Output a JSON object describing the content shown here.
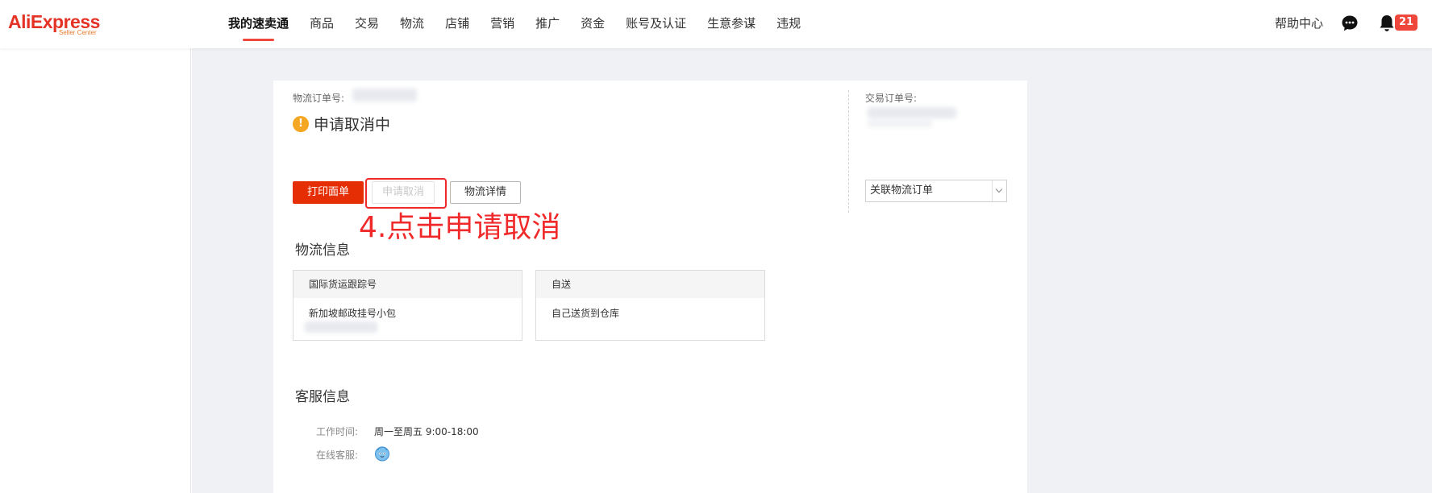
{
  "header": {
    "logo_text": "AliExpress",
    "logo_sub": "Seller Center",
    "nav": [
      "我的速卖通",
      "商品",
      "交易",
      "物流",
      "店铺",
      "营销",
      "推广",
      "资金",
      "账号及认证",
      "生意参谋",
      "违规"
    ],
    "active_index": 0,
    "help": "帮助中心",
    "notification_count": "21"
  },
  "order": {
    "logistics_order_label": "物流订单号:",
    "status": "申请取消中",
    "trade_order_label": "交易订单号:",
    "buttons": {
      "print": "打印面单",
      "cancel": "申请取消",
      "detail": "物流详情"
    },
    "related_select": "关联物流订单"
  },
  "annotation": "4.点击申请取消",
  "logistics_info": {
    "title": "物流信息",
    "boxes": [
      {
        "head": "国际货运跟踪号",
        "body": "新加坡邮政挂号小包"
      },
      {
        "head": "自送",
        "body": "自己送货到仓库"
      }
    ]
  },
  "service_info": {
    "title": "客服信息",
    "work_time_label": "工作时间:",
    "work_time_value": "周一至周五 9:00-18:00",
    "online_label": "在线客服:"
  },
  "colors": {
    "brand": "#e43225",
    "primary_button": "#e62e04",
    "annotation": "#f0292a",
    "warning": "#f5a623",
    "badge": "#f0473c"
  }
}
